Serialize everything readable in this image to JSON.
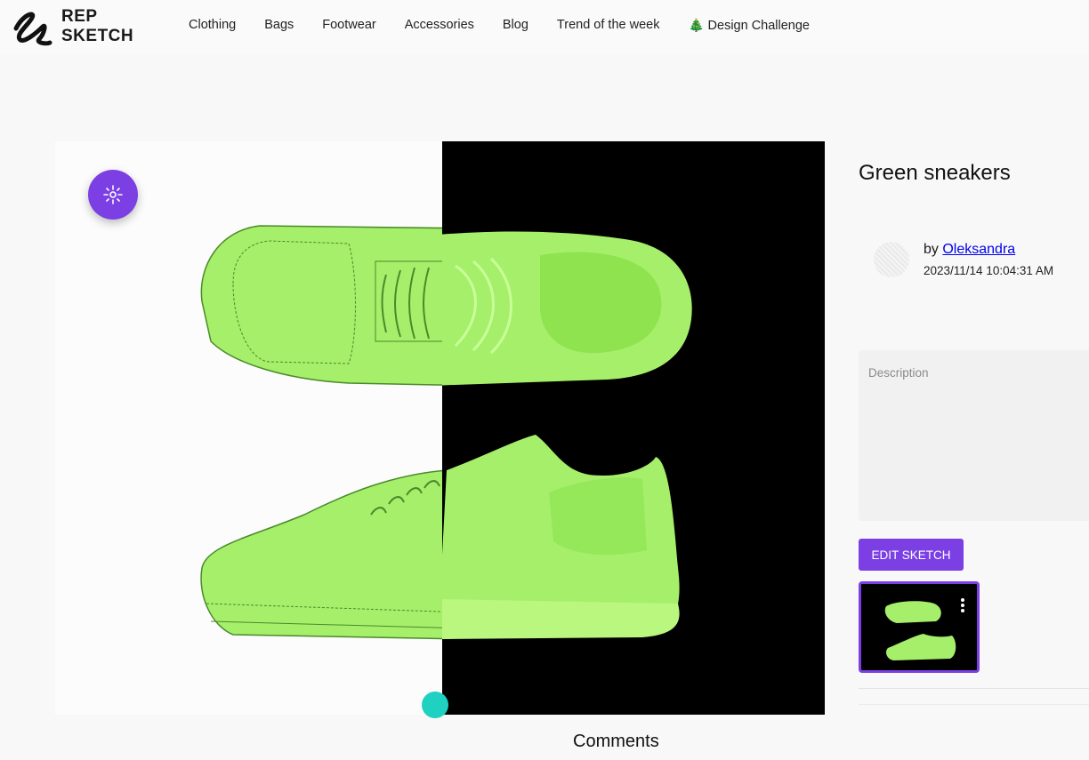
{
  "header": {
    "logo_line1": "REP",
    "logo_line2": "SKETCH",
    "nav": [
      "Clothing",
      "Bags",
      "Footwear",
      "Accessories",
      "Blog",
      "Trend of the week",
      "🎄 Design Challenge"
    ]
  },
  "sketch": {
    "title": "Green sneakers",
    "author_prefix": "by",
    "author_name": "Oleksandra",
    "timestamp": "2023/11/14 10:04:31 AM",
    "description_placeholder": "Description",
    "edit_button": "EDIT SKETCH"
  },
  "comments": {
    "heading": "Comments"
  },
  "colors": {
    "accent": "#7b3fe4",
    "shoe_green": "#a6ef6a",
    "photo_bg": "#000000",
    "link": "#0000ee"
  }
}
